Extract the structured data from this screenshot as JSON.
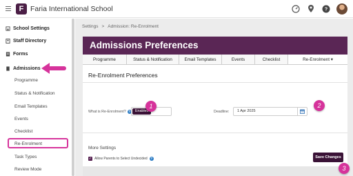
{
  "app": {
    "logo_letter": "F",
    "school_name": "Faria International School"
  },
  "topbar": {
    "icons": [
      "dashboard-icon",
      "location-pin-icon",
      "help-icon",
      "user-avatar"
    ]
  },
  "sidebar": {
    "items": [
      {
        "label": "School Settings",
        "icon": "school-icon"
      },
      {
        "label": "Staff Directory",
        "icon": "directory-icon"
      },
      {
        "label": "Forms",
        "icon": "forms-icon"
      },
      {
        "label": "Admissions",
        "icon": "admissions-icon"
      }
    ],
    "subitems": [
      {
        "label": "Programme"
      },
      {
        "label": "Status & Notification"
      },
      {
        "label": "Email Templates"
      },
      {
        "label": "Events"
      },
      {
        "label": "Checklist"
      },
      {
        "label": "Re-Enrolment"
      },
      {
        "label": "Task Types"
      },
      {
        "label": "Review Mode"
      }
    ]
  },
  "breadcrumb": {
    "root": "Settings",
    "sep": ">",
    "current": "Admission: Re-Enrolment"
  },
  "page": {
    "title": "Admissions Preferences"
  },
  "tabs": [
    {
      "label": "Programme"
    },
    {
      "label": "Status & Notification"
    },
    {
      "label": "Email Templates"
    },
    {
      "label": "Events"
    },
    {
      "label": "Checklist"
    },
    {
      "label": "Re-Enrolment ▾"
    }
  ],
  "section": {
    "title": "Re-Enrolment Preferences"
  },
  "form": {
    "reenrol_label": "What is Re-Enrolment?",
    "reenrol_value": "Enabled",
    "deadline_label": "Deadline:",
    "deadline_value": "1 Apr 2025"
  },
  "more": {
    "title": "More Settings",
    "allow_undecided_label": "Allow Parents to Select Undecided",
    "allow_undecided_checked": true
  },
  "actions": {
    "save_label": "Save Changes"
  },
  "markers": {
    "m1": "1",
    "m2": "2",
    "m3": "3"
  },
  "colors": {
    "brand": "#5a2655",
    "highlight": "#d6339b",
    "dark_button": "#3a1236"
  }
}
